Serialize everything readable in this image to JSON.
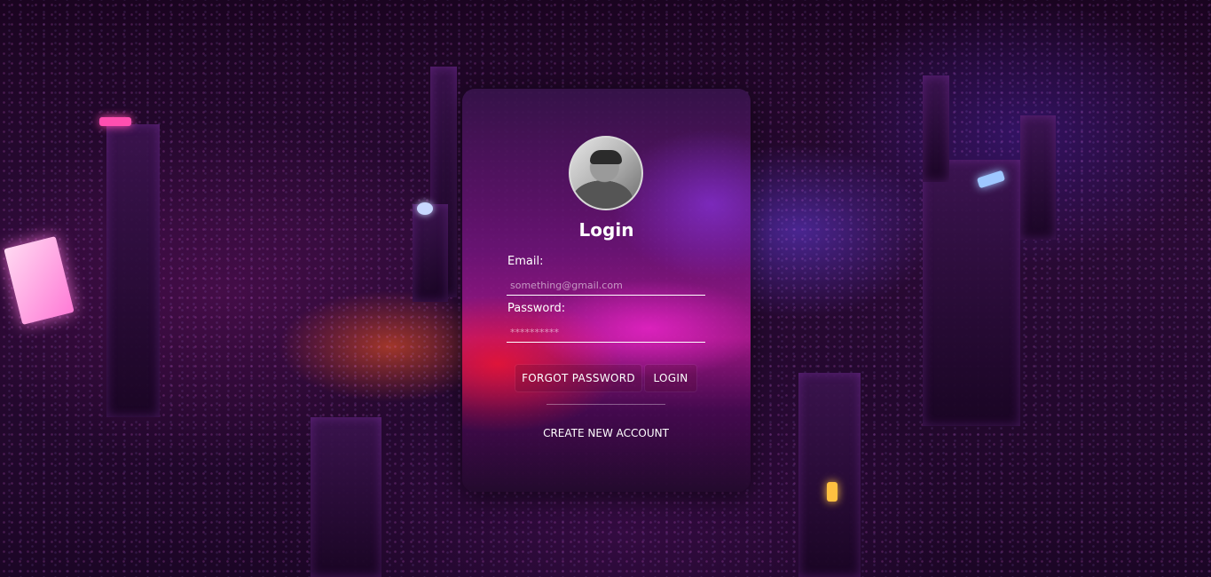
{
  "login": {
    "title": "Login",
    "email_label": "Email:",
    "email_placeholder": "something@gmail.com",
    "password_label": "Password:",
    "password_placeholder": "**********",
    "forgot_label": "FORGOT PASSWORD",
    "login_label": "LOGIN",
    "create_label": "CREATE NEW ACCOUNT"
  },
  "colors": {
    "text": "#ffffff",
    "accent_pink": "#e020c8",
    "accent_red": "#ff1428",
    "background": "#2a0a35"
  },
  "icons": {
    "avatar": "profile-photo"
  }
}
